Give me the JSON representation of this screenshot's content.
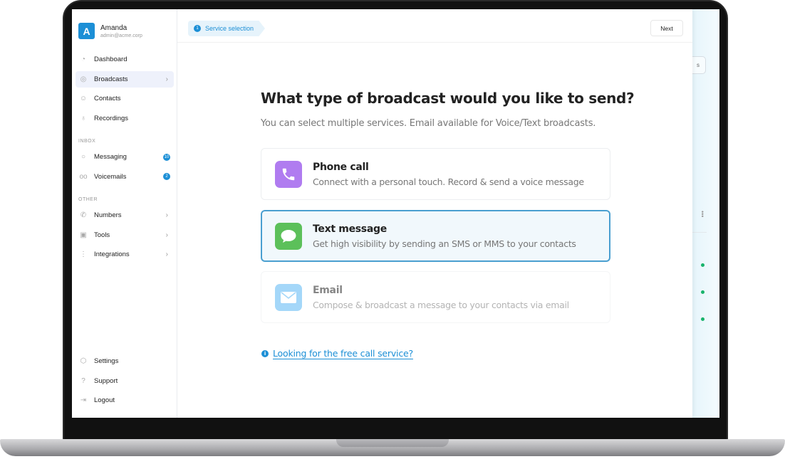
{
  "user": {
    "initial": "A",
    "name": "Amanda",
    "email": "admin@acme.corp"
  },
  "sidebar": {
    "main": [
      {
        "label": "Dashboard",
        "icon": "dashboard-icon"
      },
      {
        "label": "Broadcasts",
        "icon": "broadcast-icon",
        "active": true,
        "chevron": true
      },
      {
        "label": "Contacts",
        "icon": "contacts-icon"
      },
      {
        "label": "Recordings",
        "icon": "microphone-icon"
      }
    ],
    "inbox_label": "INBOX",
    "inbox": [
      {
        "label": "Messaging",
        "icon": "chat-icon",
        "badge": "10"
      },
      {
        "label": "Voicemails",
        "icon": "voicemail-icon",
        "badge": "2"
      }
    ],
    "other_label": "OTHER",
    "other": [
      {
        "label": "Numbers",
        "icon": "phone-icon",
        "chevron": true
      },
      {
        "label": "Tools",
        "icon": "tools-icon",
        "chevron": true
      },
      {
        "label": "Integrations",
        "icon": "integrations-icon",
        "chevron": true
      }
    ],
    "bottom": [
      {
        "label": "Settings",
        "icon": "gear-icon"
      },
      {
        "label": "Support",
        "icon": "help-icon"
      },
      {
        "label": "Logout",
        "icon": "logout-icon"
      }
    ]
  },
  "header": {
    "step_number": "1",
    "step_label": "Service selection",
    "next_label": "Next"
  },
  "main": {
    "title": "What type of broadcast would you like to send?",
    "subtitle": "You can select multiple services. Email available for Voice/Text broadcasts.",
    "options": [
      {
        "title": "Phone call",
        "description": "Connect with a personal touch. Record & send a voice message",
        "color": "#b07cf0",
        "icon": "phone-icon",
        "selected": false
      },
      {
        "title": "Text message",
        "description": "Get high visibility by sending an SMS or MMS to your contacts",
        "color": "#5cc05a",
        "icon": "message-icon",
        "selected": true
      },
      {
        "title": "Email",
        "description": "Compose & broadcast a message to your contacts via email",
        "color": "#5ab8f5",
        "icon": "envelope-icon",
        "selected": false,
        "disabled": true
      }
    ],
    "link": "Looking for the free call service?"
  },
  "background": {
    "button_fragment": "s"
  },
  "colors": {
    "accent": "#1c8fd6",
    "selected_border": "#4a9fd0",
    "status_green": "#18b36b"
  }
}
